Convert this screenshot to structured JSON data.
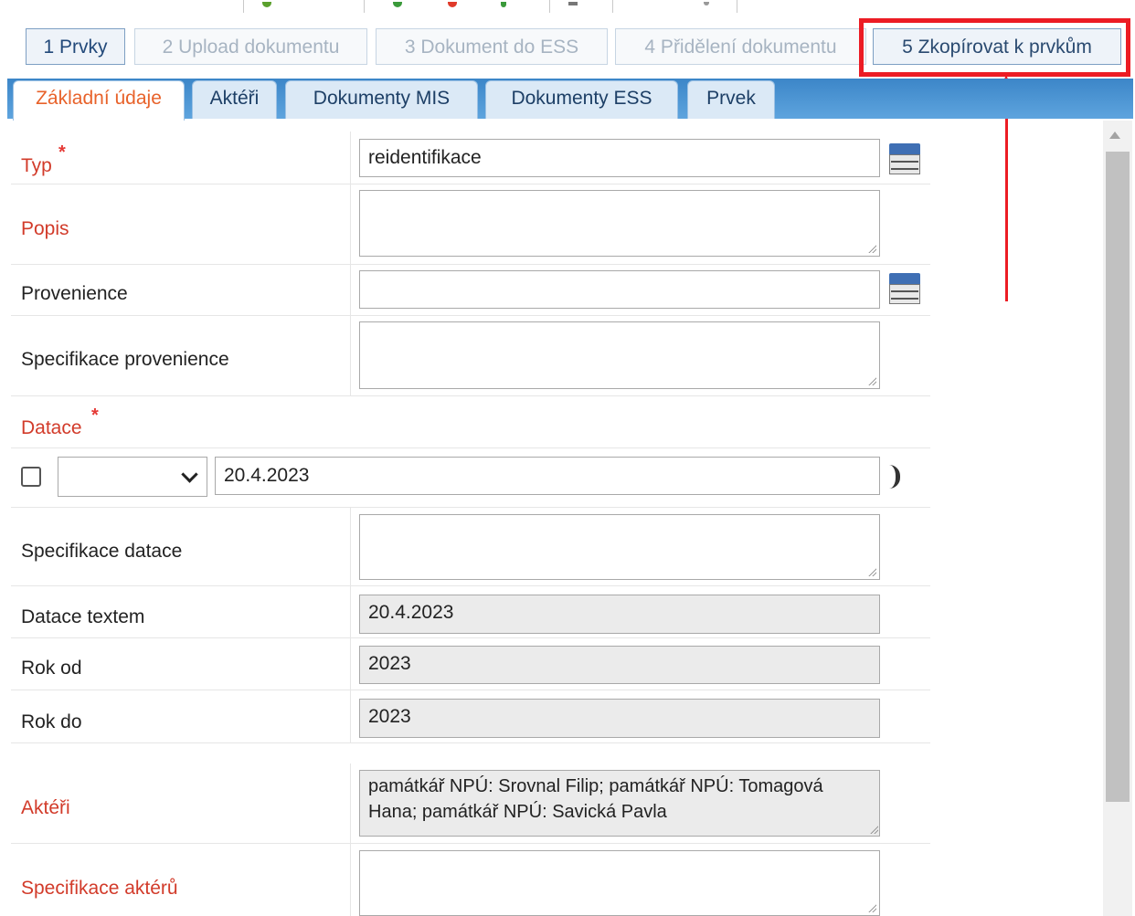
{
  "steps": [
    {
      "label": "1 Prvky"
    },
    {
      "label": "2 Upload dokumentu"
    },
    {
      "label": "3 Dokument do ESS"
    },
    {
      "label": "4 Přidělení dokumentu"
    },
    {
      "label": "5 Zkopírovat k prvkům"
    }
  ],
  "tabs": [
    {
      "label": "Základní údaje"
    },
    {
      "label": "Aktéři"
    },
    {
      "label": "Dokumenty MIS"
    },
    {
      "label": "Dokumenty ESS"
    },
    {
      "label": "Prvek"
    }
  ],
  "form": {
    "typ": {
      "label": "Typ",
      "required": "*",
      "value": "reidentifikace"
    },
    "popis": {
      "label": "Popis",
      "value": ""
    },
    "provenience": {
      "label": "Provenience",
      "value": ""
    },
    "specifikace_provenience": {
      "label": "Specifikace provenience",
      "value": ""
    },
    "datace": {
      "label": "Datace",
      "required": "*",
      "select_value": "",
      "date_value": "20.4.2023"
    },
    "specifikace_datace": {
      "label": "Specifikace datace",
      "value": ""
    },
    "datace_textem": {
      "label": "Datace textem",
      "value": "20.4.2023"
    },
    "rok_od": {
      "label": "Rok od",
      "value": "2023"
    },
    "rok_do": {
      "label": "Rok do",
      "value": "2023"
    },
    "akteri": {
      "label": "Aktéři",
      "value": "památkář NPÚ: Srovnal Filip; památkář NPÚ: Tomagová Hana; památkář NPÚ: Savická Pavla"
    },
    "specifikace_akteru": {
      "label": "Specifikace aktérů",
      "value": ""
    }
  },
  "colors": {
    "highlight": "#ec1c24",
    "required_label": "#d23b2a",
    "active_tab_text": "#e8622a",
    "tab_bar": "#4a93d3"
  }
}
